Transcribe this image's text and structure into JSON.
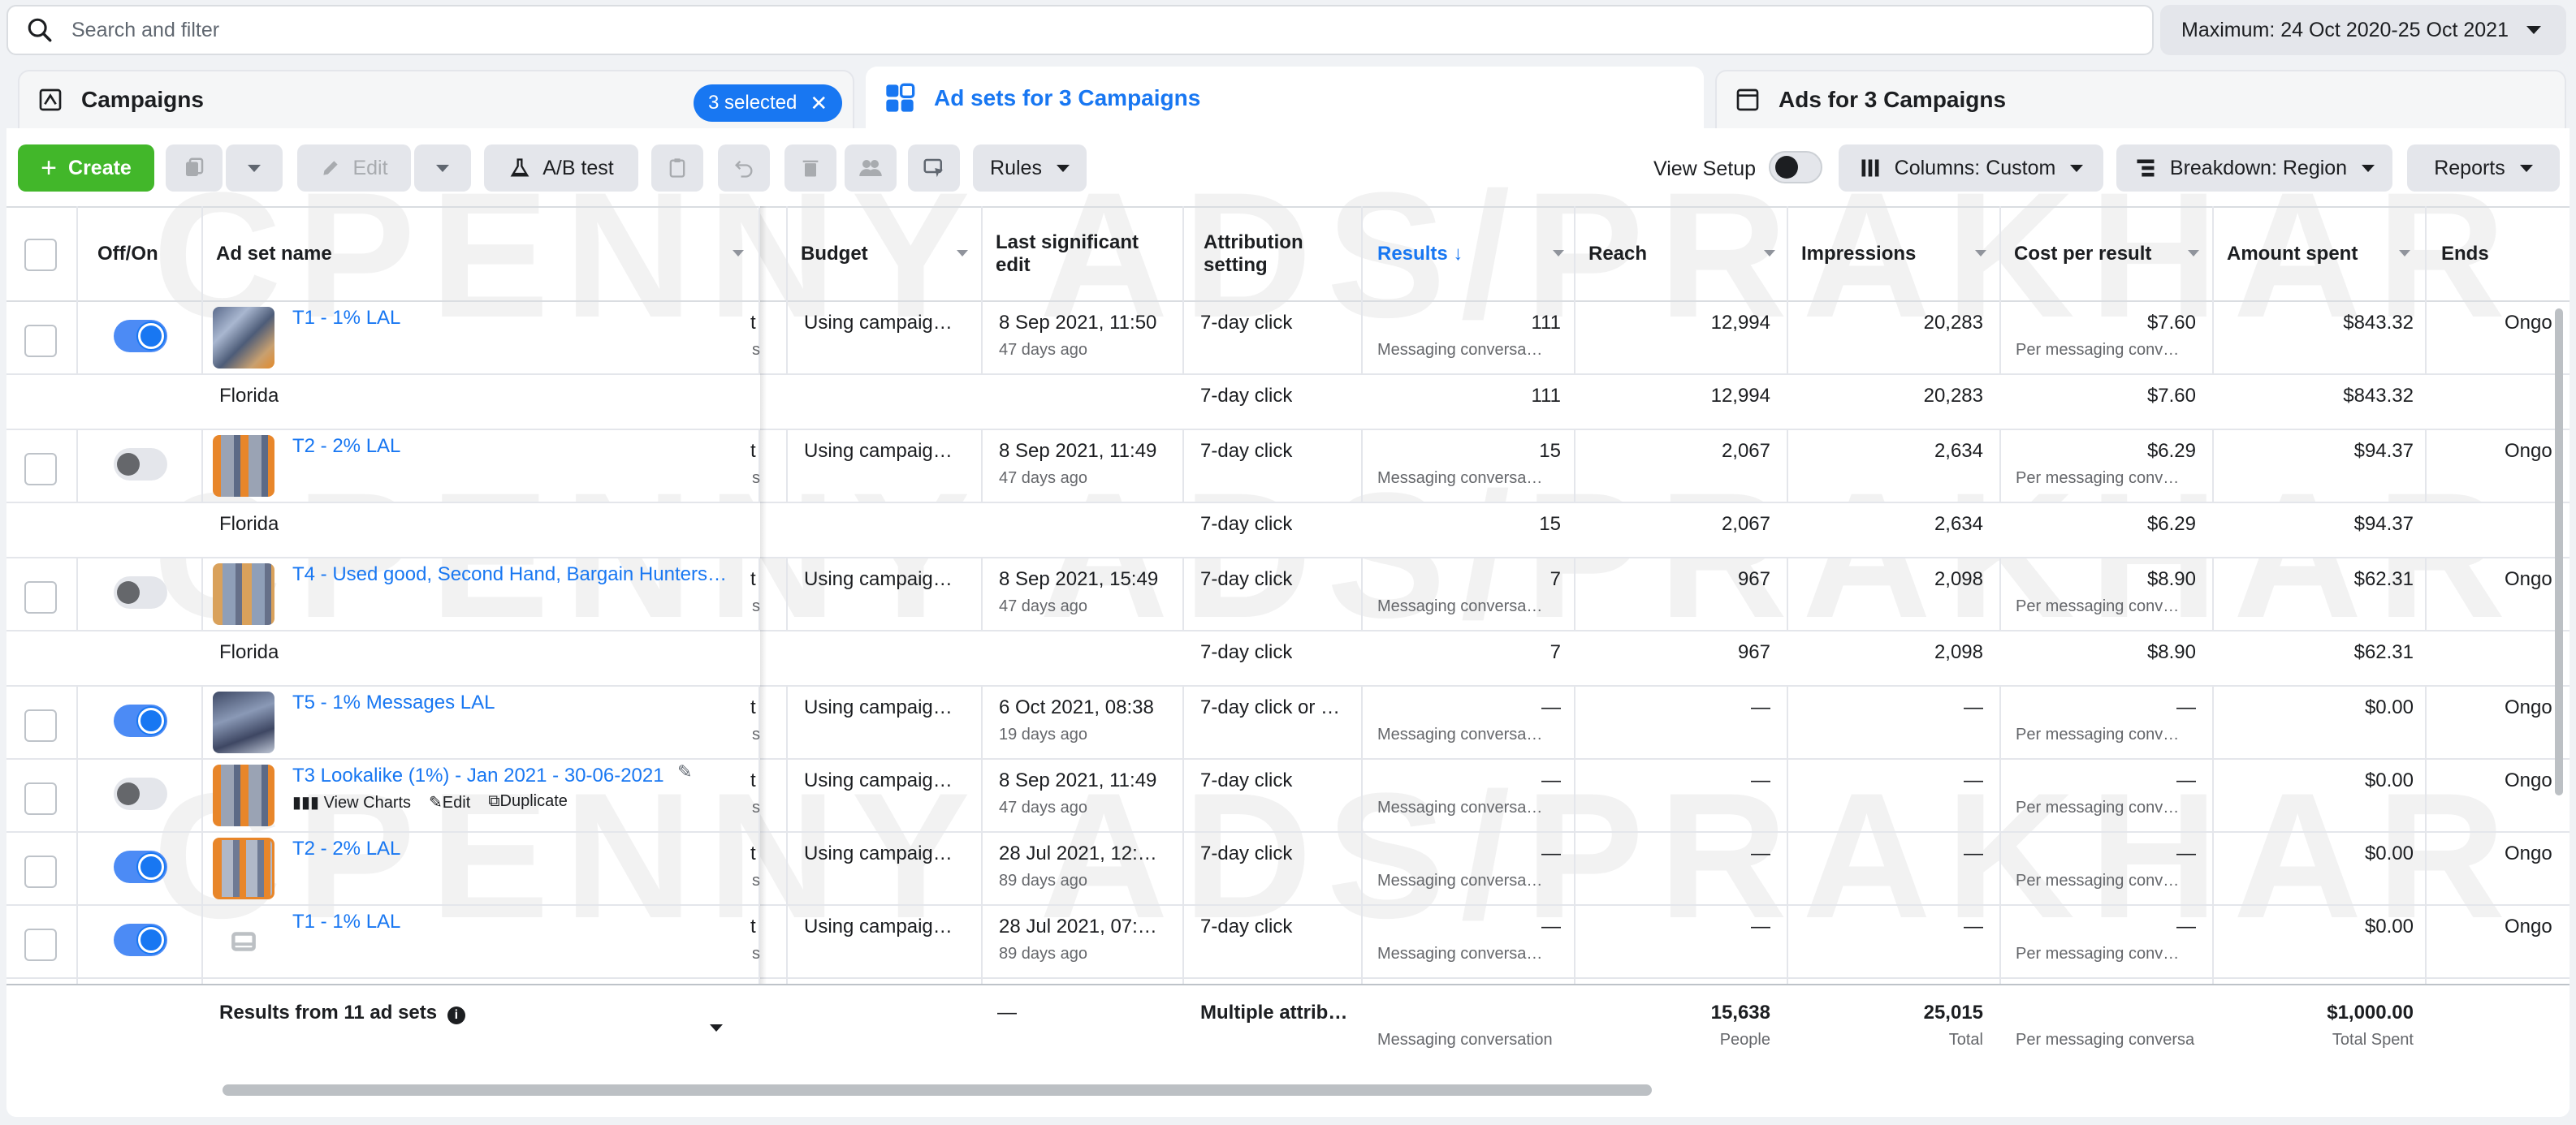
{
  "search": {
    "placeholder": "Search and filter"
  },
  "date_range": {
    "label": "Maximum: 24 Oct 2020-25 Oct 2021"
  },
  "tabs": {
    "campaigns": {
      "label": "Campaigns",
      "selected_label": "3 selected"
    },
    "adsets": {
      "label": "Ad sets for 3 Campaigns"
    },
    "ads": {
      "label": "Ads for 3 Campaigns"
    }
  },
  "toolbar": {
    "create": "Create",
    "edit": "Edit",
    "ab_test": "A/B test",
    "rules": "Rules",
    "view_setup": "View Setup",
    "columns": "Columns: Custom",
    "breakdown": "Breakdown: Region",
    "reports": "Reports"
  },
  "columns": {
    "off_on": "Off/On",
    "name": "Ad set name",
    "budget": "Budget",
    "last_edit": "Last significant edit",
    "attribution": "Attribution setting",
    "results": "Results ↓",
    "reach": "Reach",
    "impressions": "Impressions",
    "cpr": "Cost per result",
    "spent": "Amount spent",
    "ends": "Ends"
  },
  "rows": [
    {
      "name": "T1 - 1% LAL",
      "on": true,
      "frag": "t",
      "frag2": "s",
      "budget": "Using campaig…",
      "edit": "8 Sep 2021, 11:50",
      "edit_ago": "47 days ago",
      "attr": "7-day click",
      "results": "111",
      "results_sub": "Messaging conversa…",
      "reach": "12,994",
      "impr": "20,283",
      "cpr": "$7.60",
      "cpr_sub": "Per messaging conv…",
      "spent": "$843.32",
      "ends": "Ongoin"
    },
    {
      "region": "Florida",
      "attr": "7-day click",
      "results": "111",
      "reach": "12,994",
      "impr": "20,283",
      "cpr": "$7.60",
      "spent": "$843.32"
    },
    {
      "name": "T2 - 2% LAL",
      "on": false,
      "frag": "t",
      "frag2": "s",
      "budget": "Using campaig…",
      "edit": "8 Sep 2021, 11:49",
      "edit_ago": "47 days ago",
      "attr": "7-day click",
      "results": "15",
      "results_sub": "Messaging conversa…",
      "reach": "2,067",
      "impr": "2,634",
      "cpr": "$6.29",
      "cpr_sub": "Per messaging conv…",
      "spent": "$94.37",
      "ends": "Ongoin"
    },
    {
      "region": "Florida",
      "attr": "7-day click",
      "results": "15",
      "reach": "2,067",
      "impr": "2,634",
      "cpr": "$6.29",
      "spent": "$94.37"
    },
    {
      "name": "T4 - Used good, Second Hand, Bargain Hunters…",
      "on": false,
      "frag": "t",
      "frag2": "s",
      "budget": "Using campaig…",
      "edit": "8 Sep 2021, 15:49",
      "edit_ago": "47 days ago",
      "attr": "7-day click",
      "results": "7",
      "results_sub": "Messaging conversa…",
      "reach": "967",
      "impr": "2,098",
      "cpr": "$8.90",
      "cpr_sub": "Per messaging conv…",
      "spent": "$62.31",
      "ends": "Ongoin"
    },
    {
      "region": "Florida",
      "attr": "7-day click",
      "results": "7",
      "reach": "967",
      "impr": "2,098",
      "cpr": "$8.90",
      "spent": "$62.31"
    },
    {
      "name": "T5 - 1% Messages LAL",
      "on": true,
      "frag": "t",
      "frag2": "s",
      "budget": "Using campaig…",
      "edit": "6 Oct 2021, 08:38",
      "edit_ago": "19 days ago",
      "attr": "7-day click or …",
      "results": "—",
      "results_sub": "Messaging conversa…",
      "reach": "—",
      "impr": "—",
      "cpr": "—",
      "cpr_sub": "Per messaging conv…",
      "spent": "$0.00",
      "ends": "Ongoin"
    },
    {
      "name": "T3 Lookalike (1%) - Jan 2021 - 30-06-2021",
      "on": false,
      "hover": true,
      "frag": "t",
      "frag2": "s",
      "budget": "Using campaig…",
      "edit": "8 Sep 2021, 11:49",
      "edit_ago": "47 days ago",
      "attr": "7-day click",
      "results": "—",
      "results_sub": "Messaging conversa…",
      "reach": "—",
      "impr": "—",
      "cpr": "—",
      "cpr_sub": "Per messaging conv…",
      "spent": "$0.00",
      "ends": "Ongoin"
    },
    {
      "name": "T2 - 2% LAL",
      "on": true,
      "frag": "t",
      "frag2": "s",
      "budget": "Using campaig…",
      "edit": "28 Jul 2021, 12:…",
      "edit_ago": "89 days ago",
      "attr": "7-day click",
      "results": "—",
      "results_sub": "Messaging conversa…",
      "reach": "—",
      "impr": "—",
      "cpr": "—",
      "cpr_sub": "Per messaging conv…",
      "spent": "$0.00",
      "ends": "Ongoin"
    },
    {
      "name": "T1 - 1% LAL",
      "on": true,
      "frag": "t",
      "frag2": "s",
      "budget": "Using campaig…",
      "edit": "28 Jul 2021, 07:…",
      "edit_ago": "89 days ago",
      "attr": "7-day click",
      "results": "—",
      "results_sub": "Messaging conversa…",
      "reach": "—",
      "impr": "—",
      "cpr": "—",
      "cpr_sub": "Per messaging conv…",
      "spent": "$0.00",
      "ends": "Ongoin"
    }
  ],
  "row_actions": {
    "view_charts": "View Charts",
    "edit": "Edit",
    "duplicate": "Duplicate"
  },
  "footer": {
    "label": "Results from 11 ad sets",
    "edit": "—",
    "attr": "Multiple attrib…",
    "results_sub": "Messaging conversation",
    "reach": "15,638",
    "reach_sub": "People",
    "impr": "25,015",
    "impr_sub": "Total",
    "cpr_sub": "Per messaging conversa",
    "spent": "$1,000.00",
    "spent_sub": "Total Spent"
  },
  "watermark": "CPENNY ADS/PRAKHAR GUPTA",
  "colors": {
    "accent": "#1877f2",
    "create": "#42b72a",
    "border": "#e4e6eb"
  }
}
